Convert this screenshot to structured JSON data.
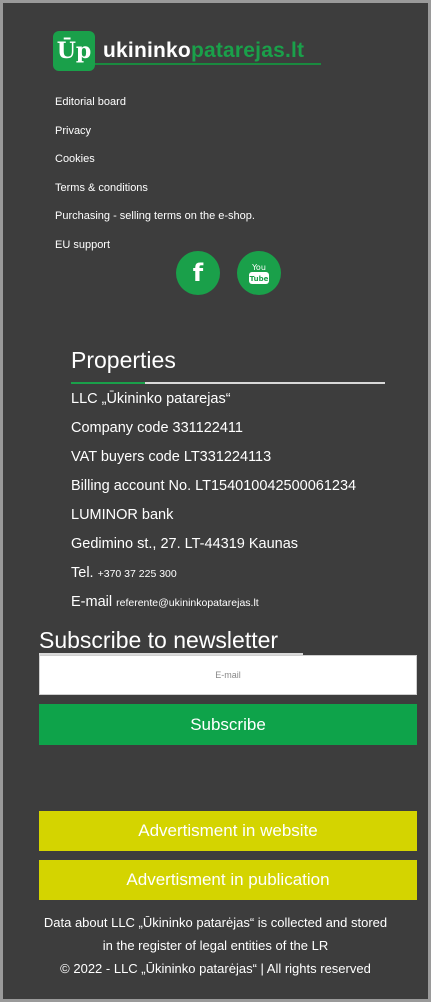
{
  "brand": {
    "logo_mark": "Ūp",
    "name_part1": "ukininko",
    "name_part2": "patarejas.lt",
    "accent_color": "#1aa04a"
  },
  "footer_links": [
    {
      "label": "Editorial board"
    },
    {
      "label": "Privacy"
    },
    {
      "label": "Cookies"
    },
    {
      "label": "Terms & conditions"
    },
    {
      "label": "Purchasing - selling terms on the e-shop."
    },
    {
      "label": "EU support"
    }
  ],
  "social": {
    "facebook_icon": "facebook-icon",
    "youtube_icon": "youtube-icon",
    "facebook_glyph": "f",
    "youtube_glyph": "You Tube"
  },
  "properties": {
    "title": "Properties",
    "company": "LLC „Ūkininko patarejas“",
    "company_code": "Company code 331122411",
    "vat": "VAT buyers code LT331224113",
    "billing": "Billing account No. LT154010042500061234",
    "bank": "LUMINOR bank",
    "address": "Gedimino st., 27. LT-44319 Kaunas",
    "tel_label": "Tel.",
    "tel_value": "+370 37 225 300",
    "email_label": "E-mail",
    "email_value": "referente@ukininkopatarejas.lt"
  },
  "newsletter": {
    "title": "Subscribe to newsletter",
    "email_placeholder": "E-mail",
    "subscribe_label": "Subscribe"
  },
  "ads": {
    "website_label": "Advertisment in website",
    "publication_label": "Advertisment in publication",
    "color": "#d4d400"
  },
  "legal": {
    "line1": "Data about LLC „Ūkininko patarėjas“ is collected and stored",
    "line2": "in the register of legal entities of the LR",
    "line3": "© 2022 - LLC „Ūkininko patarėjas“ | All rights reserved"
  }
}
